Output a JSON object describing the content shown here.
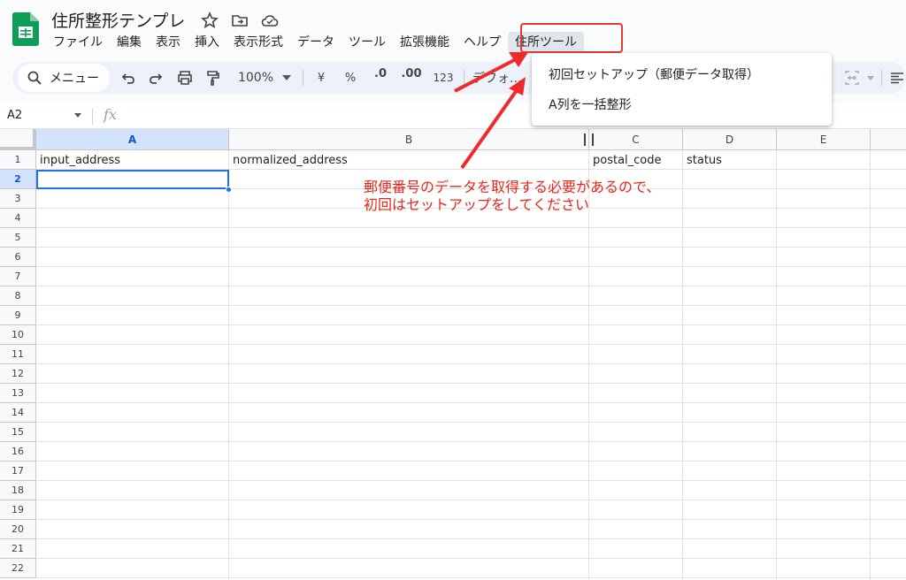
{
  "doc": {
    "title": "住所整形テンプレ"
  },
  "menu": {
    "items": [
      "ファイル",
      "編集",
      "表示",
      "挿入",
      "表示形式",
      "データ",
      "ツール",
      "拡張機能",
      "ヘルプ",
      "住所ツール"
    ]
  },
  "toolbar": {
    "search_label": "メニュー",
    "zoom": "100%",
    "currency": "¥",
    "percent": "%",
    "decrease_decimal": ".0",
    "increase_decimal": ".00",
    "number_format": "123",
    "font": "デフォ..."
  },
  "dropdown": {
    "items": [
      "初回セットアップ（郵便データ取得）",
      "A列を一括整形"
    ]
  },
  "formula_bar": {
    "name_box": "A2",
    "fx": "fx"
  },
  "grid": {
    "columns": [
      "A",
      "B",
      "C",
      "D",
      "E"
    ],
    "rows": [
      "1",
      "2",
      "3",
      "4",
      "5",
      "6",
      "7",
      "8",
      "9",
      "10",
      "11",
      "12",
      "13",
      "14",
      "15",
      "16",
      "17",
      "18",
      "19",
      "20",
      "21",
      "22"
    ],
    "headers": [
      "input_address",
      "normalized_address",
      "postal_code",
      "status"
    ],
    "selected_cell": "A2"
  },
  "annotation": {
    "line1": "郵便番号のデータを取得する必要があるので、",
    "line2": "初回はセットアップをしてください"
  },
  "colors": {
    "accent": "#1a73e8",
    "annotation": "#e8261c",
    "sheets_green": "#0f9d58"
  }
}
